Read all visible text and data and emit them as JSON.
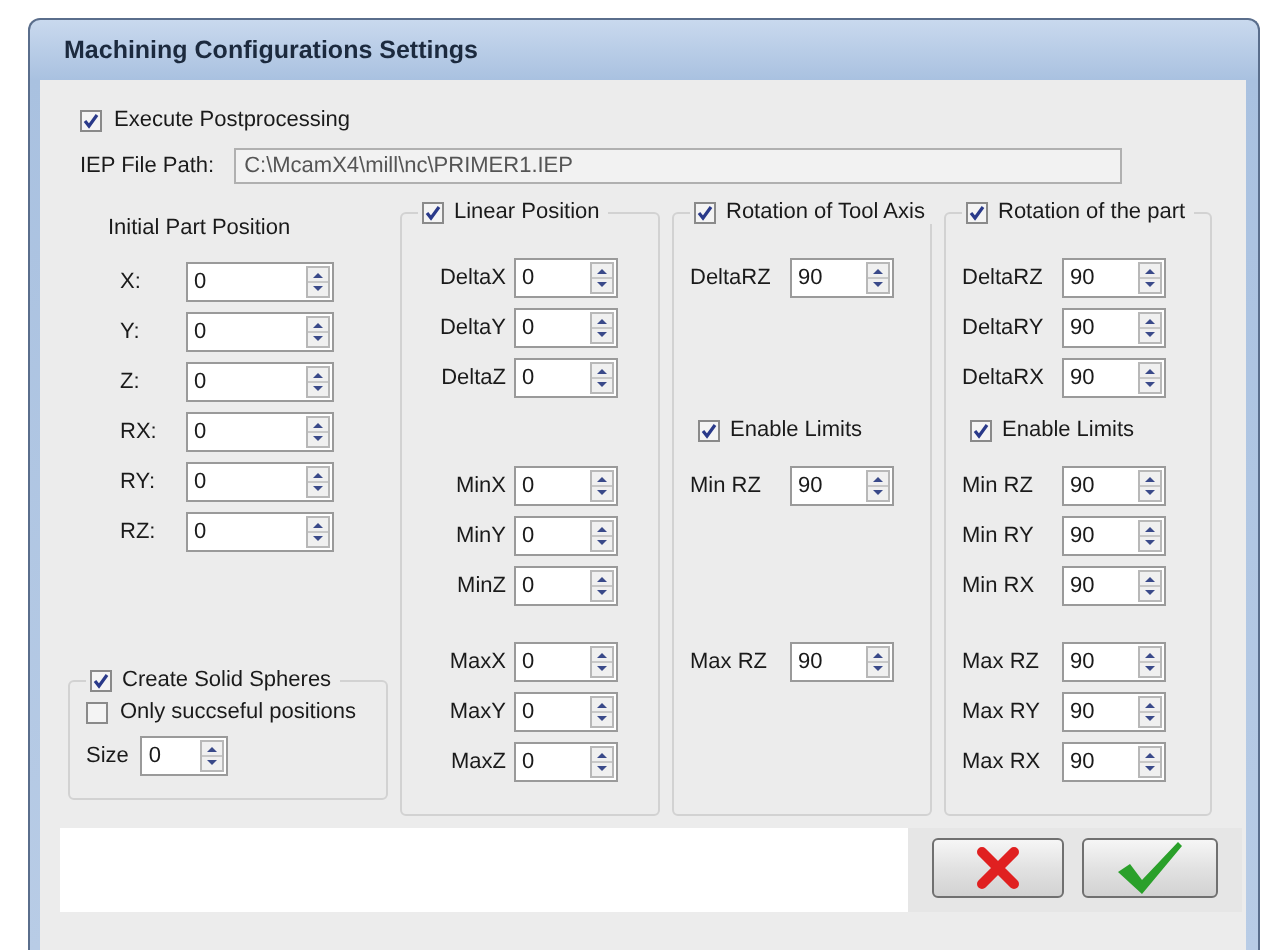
{
  "window": {
    "title": "Machining Configurations Settings"
  },
  "execute_postprocessing": {
    "label": "Execute Postprocessing",
    "checked": true
  },
  "iep_file_path": {
    "label": "IEP File Path:",
    "value": "C:\\McamX4\\mill\\nc\\PRIMER1.IEP"
  },
  "initial_part_position": {
    "title": "Initial Part Position",
    "fields": [
      {
        "label": "X:",
        "value": "0"
      },
      {
        "label": "Y:",
        "value": "0"
      },
      {
        "label": "Z:",
        "value": "0"
      },
      {
        "label": "RX:",
        "value": "0"
      },
      {
        "label": "RY:",
        "value": "0"
      },
      {
        "label": "RZ:",
        "value": "0"
      }
    ]
  },
  "create_solid_spheres": {
    "label": "Create Solid Spheres",
    "checked": true,
    "only_successful": {
      "label": "Only succseful positions",
      "checked": false
    },
    "size": {
      "label": "Size",
      "value": "0"
    }
  },
  "groups": [
    {
      "label": "Linear Position",
      "checked": true,
      "sections": [
        {
          "fields": [
            {
              "label": "DeltaX",
              "value": "0"
            },
            {
              "label": "DeltaY",
              "value": "0"
            },
            {
              "label": "DeltaZ",
              "value": "0"
            }
          ]
        },
        {
          "fields": [
            {
              "label": "MinX",
              "value": "0"
            },
            {
              "label": "MinY",
              "value": "0"
            },
            {
              "label": "MinZ",
              "value": "0"
            }
          ]
        },
        {
          "fields": [
            {
              "label": "MaxX",
              "value": "0"
            },
            {
              "label": "MaxY",
              "value": "0"
            },
            {
              "label": "MaxZ",
              "value": "0"
            }
          ]
        }
      ]
    },
    {
      "label": "Rotation of Tool Axis",
      "checked": true,
      "sections": [
        {
          "fields": [
            {
              "label": "DeltaRZ",
              "value": "90"
            }
          ]
        },
        {
          "limits": {
            "label": "Enable Limits",
            "checked": true
          },
          "fields": [
            {
              "label": "Min RZ",
              "value": "90"
            }
          ]
        },
        {
          "fields": [
            {
              "label": "Max RZ",
              "value": "90"
            }
          ]
        }
      ]
    },
    {
      "label": "Rotation of the part",
      "checked": true,
      "sections": [
        {
          "fields": [
            {
              "label": "DeltaRZ",
              "value": "90"
            },
            {
              "label": "DeltaRY",
              "value": "90"
            },
            {
              "label": "DeltaRX",
              "value": "90"
            }
          ]
        },
        {
          "limits": {
            "label": "Enable Limits",
            "checked": true
          },
          "fields": [
            {
              "label": "Min RZ",
              "value": "90"
            },
            {
              "label": "Min RY",
              "value": "90"
            },
            {
              "label": "Min RX",
              "value": "90"
            }
          ]
        },
        {
          "fields": [
            {
              "label": "Max RZ",
              "value": "90"
            },
            {
              "label": "Max RY",
              "value": "90"
            },
            {
              "label": "Max RX",
              "value": "90"
            }
          ]
        }
      ]
    }
  ],
  "buttons": [
    {
      "kind": "cancel"
    },
    {
      "kind": "ok"
    }
  ]
}
